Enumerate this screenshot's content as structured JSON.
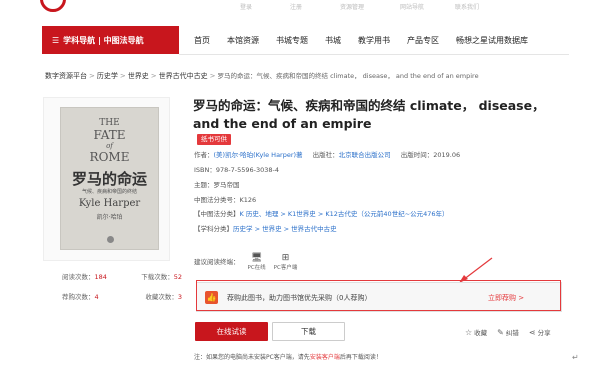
{
  "topbar": {
    "faint_items": [
      "登录",
      "注册",
      "资源管理",
      "网站导航",
      "联系我们"
    ]
  },
  "nav": {
    "subject_nav_label": "学科导航 | 中图法导航",
    "links": [
      "首页",
      "本馆资源",
      "书城专题",
      "书城",
      "教学用书",
      "产品专区",
      "畅想之星试用数据库"
    ]
  },
  "breadcrumb": {
    "items": [
      "数字资源平台",
      "历史学",
      "世界史",
      "世界古代中古史"
    ],
    "current": "罗马的命运：气候、疾病和帝国的终结 climate， disease， and the end of an empire"
  },
  "cover": {
    "line1": "THE",
    "line2": "FATE",
    "line3": "of",
    "line4": "ROME",
    "cn_title": "罗马的命运",
    "cn_sub": "气候、疾病和帝国的终结",
    "author": "Kyle Harper",
    "author_cn": "凯尔·哈珀"
  },
  "stats": {
    "read_label": "阅读次数：",
    "read_value": "184",
    "download_label": "下载次数：",
    "download_value": "52",
    "recommend_label": "荐购次数：",
    "recommend_value": "4",
    "favorite_label": "收藏次数：",
    "favorite_value": "3"
  },
  "book": {
    "title": "罗马的命运：气候、疾病和帝国的终结 climate， disease， and the end of an empire",
    "badge": "纸书可供",
    "author_label": "作者：",
    "author_value": "(美)凯尔·哈珀(Kyle Harper)著",
    "publisher_label": "出版社：",
    "publisher_value": "北京联合出版公司",
    "date_label": "出版时间：",
    "date_value": "2019.06",
    "isbn_label": "ISBN：",
    "isbn_value": "978-7-5596-3038-4",
    "subject_label": "主题：",
    "subject_value": "罗马帝国",
    "clc_label": "中图法分类号：",
    "clc_value": "K126",
    "clc_class_label": "【中图法分类】",
    "clc_class_value": "K 历史、地理 > K1世界史 > K12古代史（公元前40世纪~公元476年）",
    "subject_class_label": "【学科分类】",
    "subject_class_value": "历史学 > 世界史 > 世界古代中古史"
  },
  "read_mode": {
    "label": "建议阅读终端：",
    "options": [
      "PC在线",
      "PC客户端"
    ]
  },
  "recommend": {
    "text": "荐购此图书，助力图书馆优先采购",
    "count_text": "（0人荐购）",
    "link": "立即荐购 >"
  },
  "buttons": {
    "read_online": "在线试读",
    "download": "下载"
  },
  "actions": {
    "favorite": "收藏",
    "correct": "纠错",
    "share": "分享"
  },
  "note": {
    "prefix": "注：如果您的电脑尚未安装PC客户端，请先",
    "link": "安装客户端",
    "suffix": "后再下载阅读！"
  },
  "colors": {
    "brand_red": "#c8161d",
    "link_blue": "#2a6fc9",
    "accent_red": "#e4393c"
  }
}
